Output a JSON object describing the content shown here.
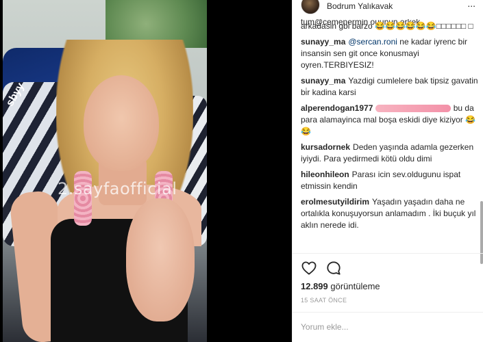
{
  "header": {
    "location": "Bodrum Yalıkavak",
    "more_label": "..."
  },
  "video": {
    "watermark": "2.sayfaofficial",
    "side_text": "sbyy"
  },
  "comments": [
    {
      "user": "",
      "text": "arkadasin gbi barzo 😂😂😂😂😂😂□□□□□□ □",
      "partial_top": "tum@cemenermin ouunun erkek"
    },
    {
      "user": "sunayy_ma",
      "mention": "@sercan.roni",
      "text": "ne kadar iyrenc bir insansin sen git once konusmayi oyren.TERBIYESIZ!"
    },
    {
      "user": "sunayy_ma",
      "text": "Yazdigi cumlelere bak tipsiz gavatin bi̇r kadina karsi"
    },
    {
      "user": "alperendogan1977",
      "redacted": true,
      "text": "bu da para alamayinca mal boşa eskidi diye kiziyor 😂😂"
    },
    {
      "user": "kursadornek",
      "text": "Deden yaşında adamla gezerken iyiydi. Para yedirmedi kötü oldu dimi"
    },
    {
      "user": "hileonhileon",
      "text": "Parası icin sev.oldugunu ispat etmissin kendin"
    },
    {
      "user": "erolmesutyildirim",
      "text": "Yaşadın yaşadın daha ne ortalıkla konuşuyorsun anlamadım . İki buçuk yıl aklın nerede idi."
    }
  ],
  "actions": {
    "like_icon": "heart-icon",
    "comment_icon": "comment-bubble-icon"
  },
  "stats": {
    "views_count": "12.899",
    "views_label": "görüntüleme",
    "time_ago": "15 SAAT ÖNCE"
  },
  "composer": {
    "placeholder": "Yorum ekle..."
  },
  "colors": {
    "text": "#262626",
    "mention": "#003569",
    "muted": "#999999",
    "divider": "#efefef"
  }
}
